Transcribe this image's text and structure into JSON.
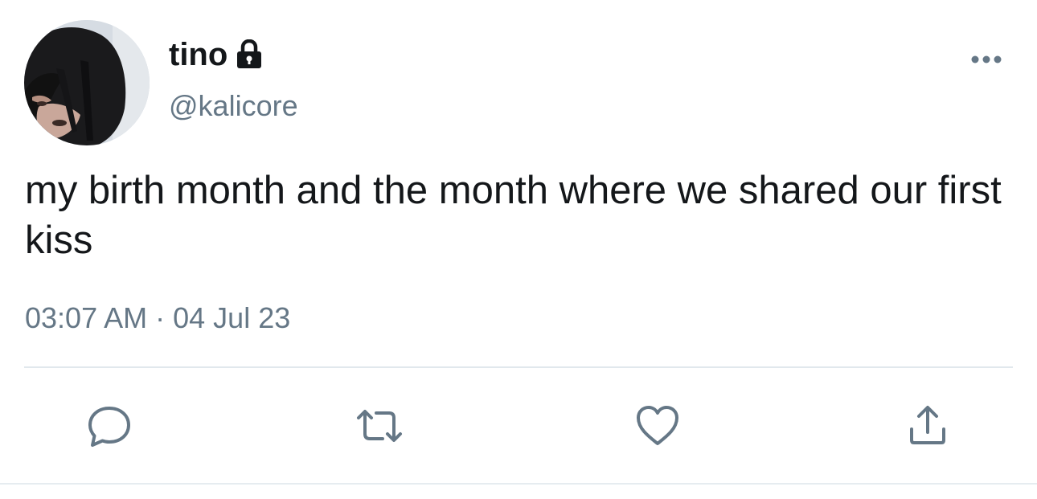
{
  "user": {
    "display_name": "tino",
    "handle": "@kalicore",
    "protected_icon": "lock-icon",
    "avatar_description": "profile photo"
  },
  "tweet": {
    "text": "my birth month and the month where we shared our first kiss",
    "time": "03:07 AM",
    "separator": "·",
    "date": "04 Jul 23"
  },
  "actions": {
    "reply_icon": "reply-icon",
    "retweet_icon": "retweet-icon",
    "like_icon": "heart-icon",
    "share_icon": "share-icon",
    "more_icon": "more-options-icon"
  },
  "colors": {
    "text_primary": "#14171a",
    "text_secondary": "#657786",
    "divider": "#e1e8ed",
    "icon": "#657786"
  }
}
